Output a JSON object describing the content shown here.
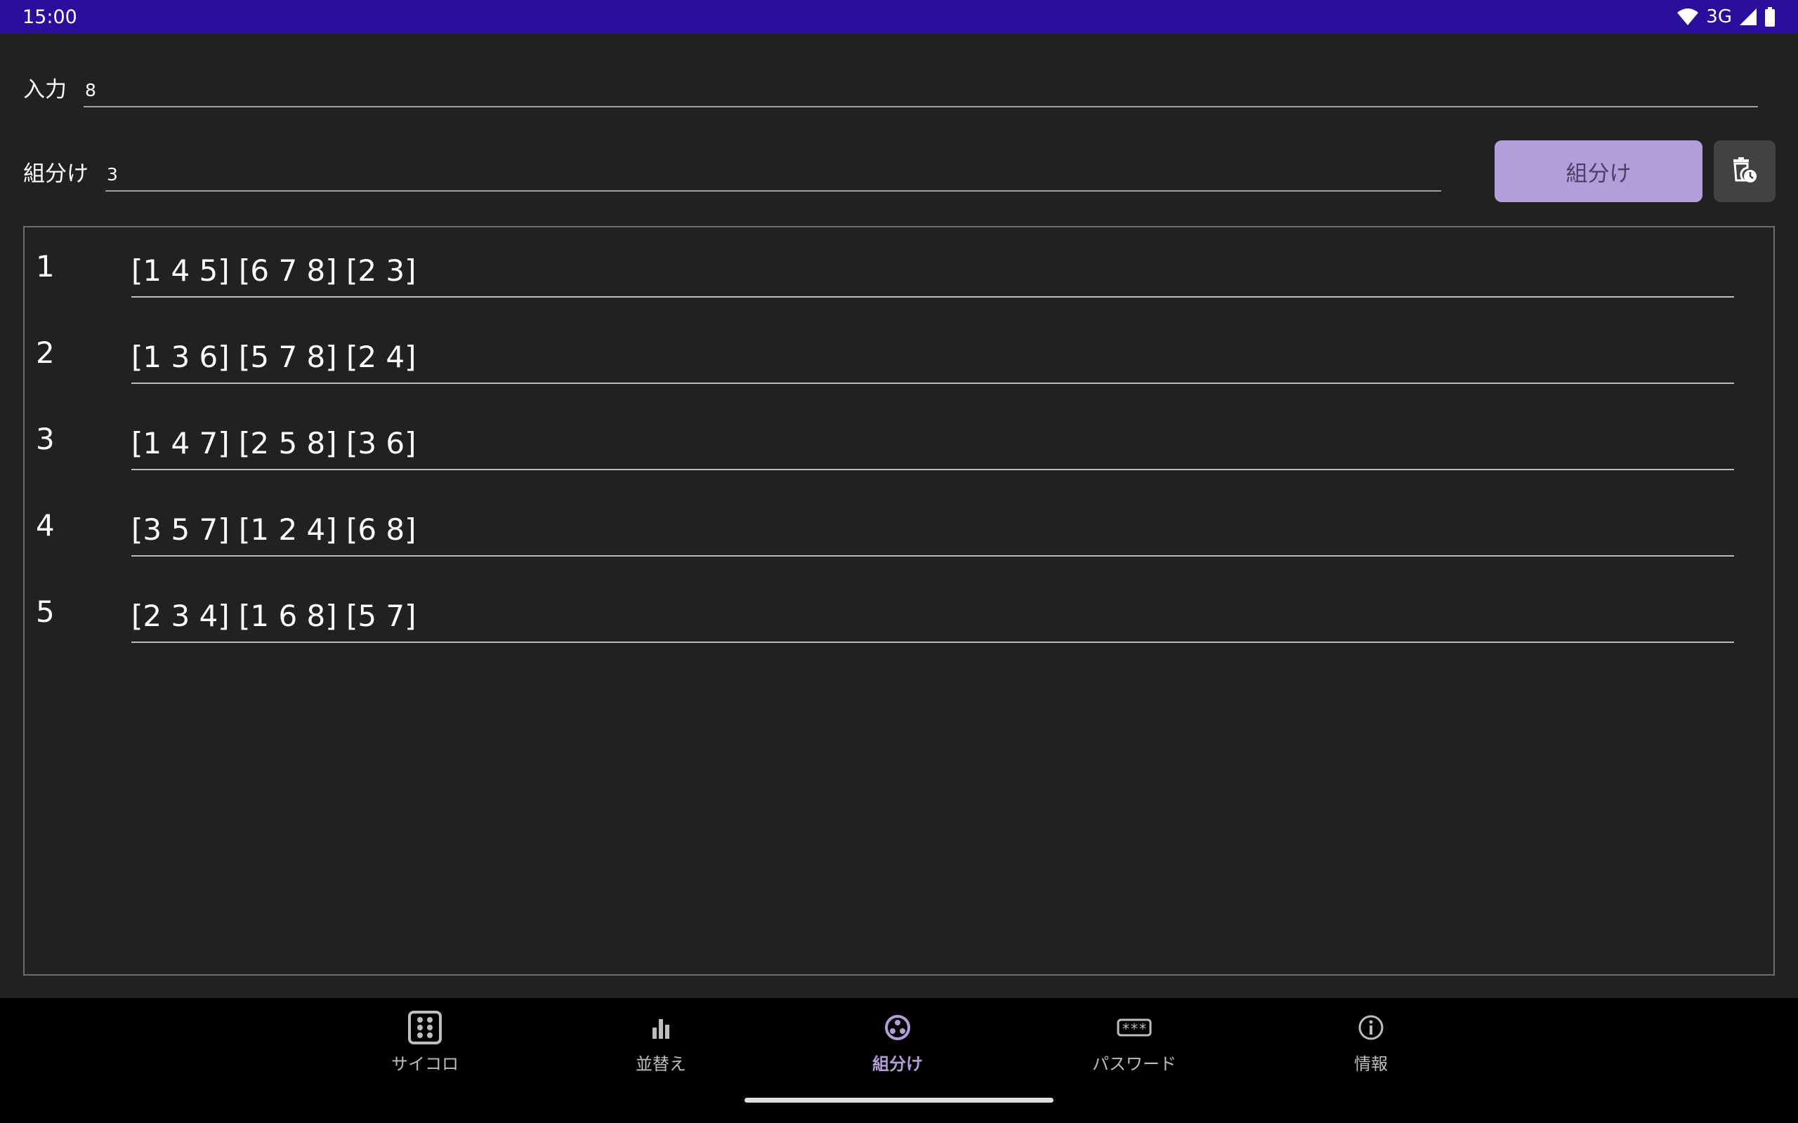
{
  "status_bar": {
    "time": "15:00",
    "network": "3G",
    "icons": [
      "wifi-icon",
      "cell-signal-icon",
      "battery-icon"
    ],
    "background": "#2a0f9c"
  },
  "input_field": {
    "label": "入力",
    "value": "8"
  },
  "group_field": {
    "label": "組分け",
    "value": "3"
  },
  "toolbar": {
    "split_button_label": "組分け",
    "history_icon": "clear-history-icon",
    "accent": "#b39ddb"
  },
  "results": [
    {
      "index": "1",
      "groups": "[1 4 5] [6 7 8] [2 3]"
    },
    {
      "index": "2",
      "groups": "[1 3 6] [5 7 8] [2 4]"
    },
    {
      "index": "3",
      "groups": "[1 4 7] [2 5 8] [3 6]"
    },
    {
      "index": "4",
      "groups": "[3 5 7] [1 2 4] [6 8]"
    },
    {
      "index": "5",
      "groups": "[2 3 4] [1 6 8] [5 7]"
    }
  ],
  "bottom_nav": {
    "items": [
      {
        "label": "サイコロ",
        "icon": "dice-icon",
        "active": false
      },
      {
        "label": "並替え",
        "icon": "bar-chart-icon",
        "active": false
      },
      {
        "label": "組分け",
        "icon": "group-icon",
        "active": true
      },
      {
        "label": "パスワード",
        "icon": "password-icon",
        "active": false
      },
      {
        "label": "情報",
        "icon": "info-icon",
        "active": false
      }
    ]
  }
}
